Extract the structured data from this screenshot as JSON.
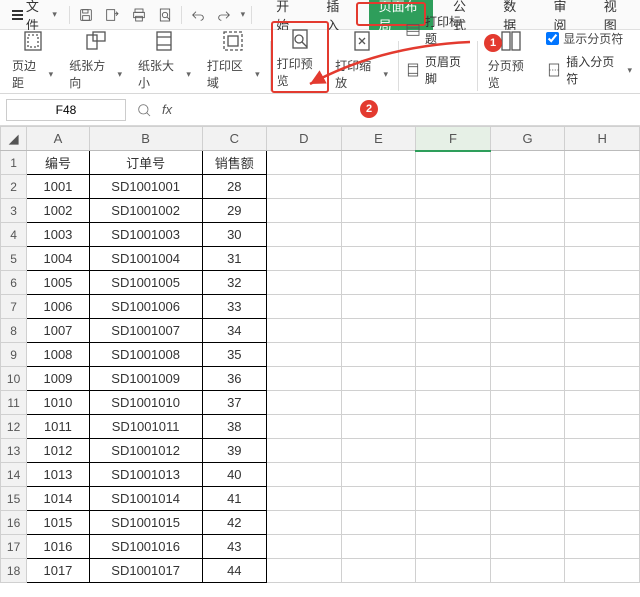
{
  "menu": {
    "file": "文件"
  },
  "tabs": {
    "start": "开始",
    "insert": "插入",
    "page_layout": "页面布局",
    "formula": "公式",
    "data": "数据",
    "review": "审阅",
    "view": "视图"
  },
  "ribbon": {
    "margins": "页边距",
    "orientation": "纸张方向",
    "size": "纸张大小",
    "print_area": "打印区域",
    "print_preview": "打印预览",
    "print_scaling": "打印缩放",
    "print_titles": "打印标题",
    "header_footer": "页眉页脚",
    "page_break_preview": "分页预览",
    "insert_page_break": "插入分页符",
    "show_page_break": "显示分页符"
  },
  "callouts": {
    "one": "1",
    "two": "2"
  },
  "namebox": "F48",
  "fx": "fx",
  "columns": [
    "A",
    "B",
    "C",
    "D",
    "E",
    "F",
    "G",
    "H"
  ],
  "headers": {
    "id": "编号",
    "order": "订单号",
    "sales": "销售额"
  },
  "rows": [
    {
      "n": "1",
      "id": "",
      "order": "",
      "sales": ""
    },
    {
      "n": "2",
      "id": "1001",
      "order": "SD1001001",
      "sales": "28"
    },
    {
      "n": "3",
      "id": "1002",
      "order": "SD1001002",
      "sales": "29"
    },
    {
      "n": "4",
      "id": "1003",
      "order": "SD1001003",
      "sales": "30"
    },
    {
      "n": "5",
      "id": "1004",
      "order": "SD1001004",
      "sales": "31"
    },
    {
      "n": "6",
      "id": "1005",
      "order": "SD1001005",
      "sales": "32"
    },
    {
      "n": "7",
      "id": "1006",
      "order": "SD1001006",
      "sales": "33"
    },
    {
      "n": "8",
      "id": "1007",
      "order": "SD1001007",
      "sales": "34"
    },
    {
      "n": "9",
      "id": "1008",
      "order": "SD1001008",
      "sales": "35"
    },
    {
      "n": "10",
      "id": "1009",
      "order": "SD1001009",
      "sales": "36"
    },
    {
      "n": "11",
      "id": "1010",
      "order": "SD1001010",
      "sales": "37"
    },
    {
      "n": "12",
      "id": "1011",
      "order": "SD1001011",
      "sales": "38"
    },
    {
      "n": "13",
      "id": "1012",
      "order": "SD1001012",
      "sales": "39"
    },
    {
      "n": "14",
      "id": "1013",
      "order": "SD1001013",
      "sales": "40"
    },
    {
      "n": "15",
      "id": "1014",
      "order": "SD1001014",
      "sales": "41"
    },
    {
      "n": "16",
      "id": "1015",
      "order": "SD1001015",
      "sales": "42"
    },
    {
      "n": "17",
      "id": "1016",
      "order": "SD1001016",
      "sales": "43"
    },
    {
      "n": "18",
      "id": "1017",
      "order": "SD1001017",
      "sales": "44"
    }
  ]
}
